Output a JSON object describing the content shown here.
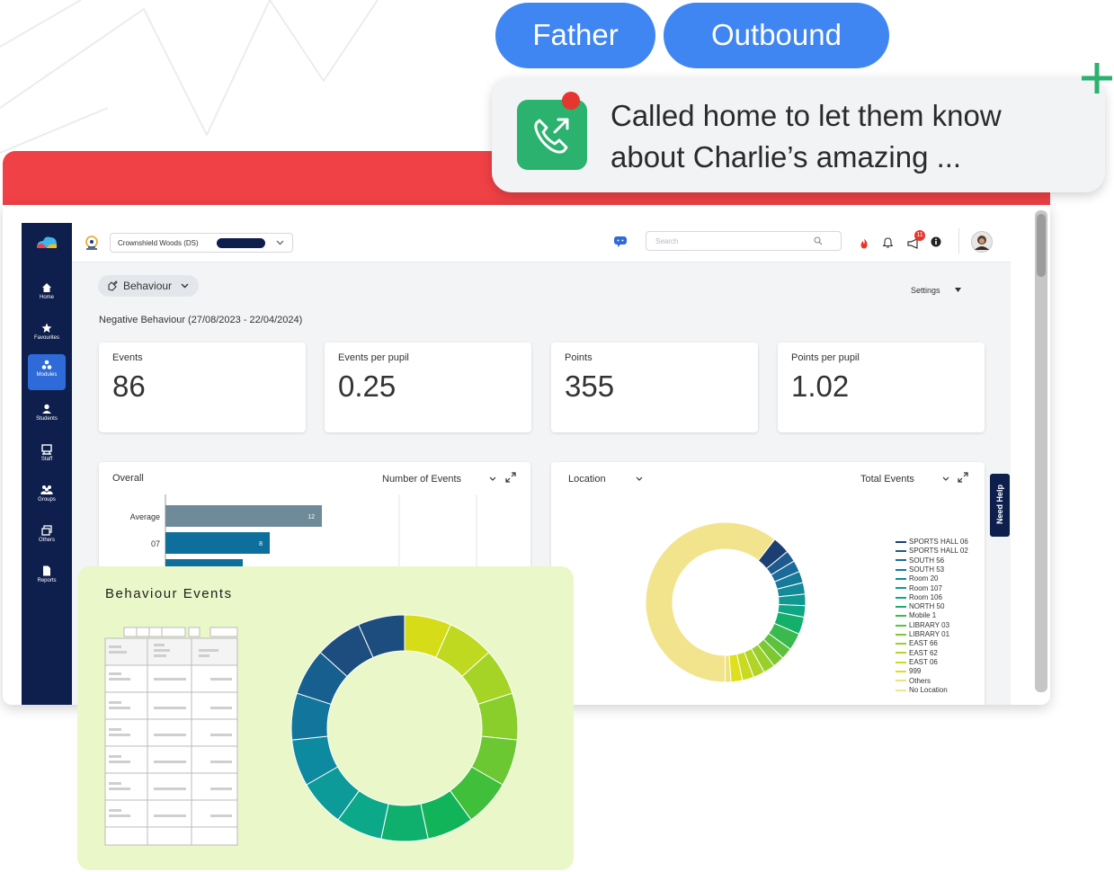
{
  "overlay": {
    "pill_father": "Father",
    "pill_outbound": "Outbound",
    "call_text_line1": "Called home to let them know",
    "call_text_line2": "about Charlie’s amazing ..."
  },
  "sidebar": {
    "items": [
      {
        "label": "Home",
        "icon": "home-icon"
      },
      {
        "label": "Favourites",
        "icon": "star-icon"
      },
      {
        "label": "Modules",
        "icon": "modules-icon",
        "active": true
      },
      {
        "label": "Students",
        "icon": "student-icon"
      },
      {
        "label": "Staff",
        "icon": "staff-icon"
      },
      {
        "label": "Groups",
        "icon": "groups-icon"
      },
      {
        "label": "Others",
        "icon": "others-icon"
      },
      {
        "label": "Reports",
        "icon": "reports-icon"
      }
    ]
  },
  "topbar": {
    "school": "Crownshield Woods (DS)",
    "search_placeholder": "Search",
    "notification_badge": "11"
  },
  "main": {
    "module": "Behaviour",
    "settings": "Settings",
    "subtitle": "Negative Behaviour (27/08/2023 - 22/04/2024)",
    "stats": [
      {
        "label": "Events",
        "value": "86"
      },
      {
        "label": "Events per pupil",
        "value": "0.25"
      },
      {
        "label": "Points",
        "value": "355"
      },
      {
        "label": "Points per pupil",
        "value": "1.02"
      }
    ],
    "overall": {
      "title": "Overall",
      "metric": "Number of Events"
    },
    "location": {
      "title": "Location",
      "metric": "Total Events"
    },
    "need_help": "Need Help"
  },
  "events_card": {
    "title": "Behaviour Events"
  },
  "colors": {
    "red_band": "#ef4146",
    "pill_blue": "#3f86f3",
    "sidebar_navy": "#0e1f4d",
    "call_green": "#2ab26e",
    "events_bg": "#eaf7c9"
  },
  "chart_data": [
    {
      "type": "bar",
      "orientation": "horizontal",
      "title": "Overall",
      "categories": [
        "Average",
        "07"
      ],
      "values": [
        12,
        8
      ],
      "data_labels": [
        "12",
        "8"
      ],
      "colors": [
        "#6f8a99",
        "#0e6f9c"
      ]
    },
    {
      "type": "pie",
      "donut": true,
      "title": "Location",
      "categories": [
        "SPORTS HALL 06",
        "SPORTS HALL 02",
        "SOUTH 56",
        "SOUTH 53",
        "Room 20",
        "Room 107",
        "Room 106",
        "NORTH 50",
        "Mobile 1",
        "LIBRARY 03",
        "LIBRARY 01",
        "EAST 66",
        "EAST 62",
        "EAST 06",
        "999",
        "Others",
        "No Location"
      ],
      "values": [
        3,
        2,
        2,
        2,
        2,
        2,
        2,
        3,
        3,
        2,
        2,
        2,
        2,
        2,
        2,
        1,
        52
      ],
      "colors": [
        "#1b3f72",
        "#1d5b8f",
        "#1a6b99",
        "#167a99",
        "#138a98",
        "#109892",
        "#0ea684",
        "#12b06a",
        "#3ab94e",
        "#5cc13c",
        "#7cc832",
        "#97cf2b",
        "#b0d526",
        "#c8da22",
        "#dfe01d",
        "#eee07a",
        "#f2e48c"
      ],
      "legend_position": "right"
    },
    {
      "type": "pie",
      "donut": true,
      "title": "Behaviour Events",
      "values": [
        1,
        1,
        1,
        1,
        1,
        1,
        1,
        1,
        1,
        1,
        1,
        1,
        1,
        1,
        1
      ],
      "colors": [
        "#1c4d7e",
        "#1c4d7e",
        "#175f8f",
        "#11759c",
        "#0d8aa0",
        "#0c9b98",
        "#0ca88a",
        "#0fb06e",
        "#12b45a",
        "#3fbf3a",
        "#6bc832",
        "#8ace2c",
        "#a6d426",
        "#bfd920",
        "#d6dd18"
      ]
    }
  ]
}
